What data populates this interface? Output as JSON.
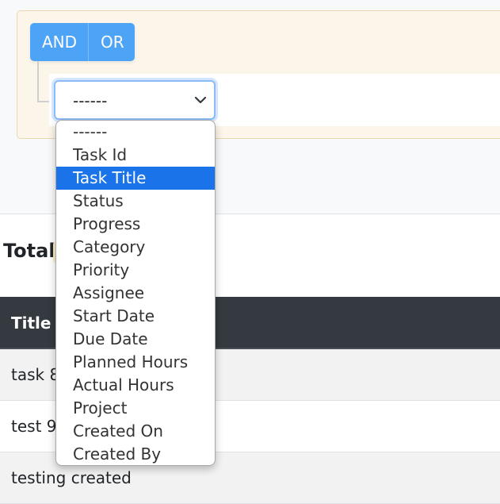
{
  "query_builder": {
    "and_label": "AND",
    "or_label": "OR",
    "field_select": {
      "current_value": "------",
      "options": [
        "------",
        "Task Id",
        "Task Title",
        "Status",
        "Progress",
        "Category",
        "Priority",
        "Assignee",
        "Start Date",
        "Due Date",
        "Planned Hours",
        "Actual Hours",
        "Project",
        "Created On",
        "Created By"
      ],
      "highlighted_option": "Task Title"
    }
  },
  "summary": {
    "total_label": "Total"
  },
  "table": {
    "header_title": "Title",
    "rows": [
      "task 88",
      "test 99",
      "testing created"
    ]
  },
  "colors": {
    "button_bg": "#4da3f5",
    "highlight": "#1a73e8",
    "table_header_bg": "#343a40",
    "panel_bg": "#fcf6ea"
  }
}
